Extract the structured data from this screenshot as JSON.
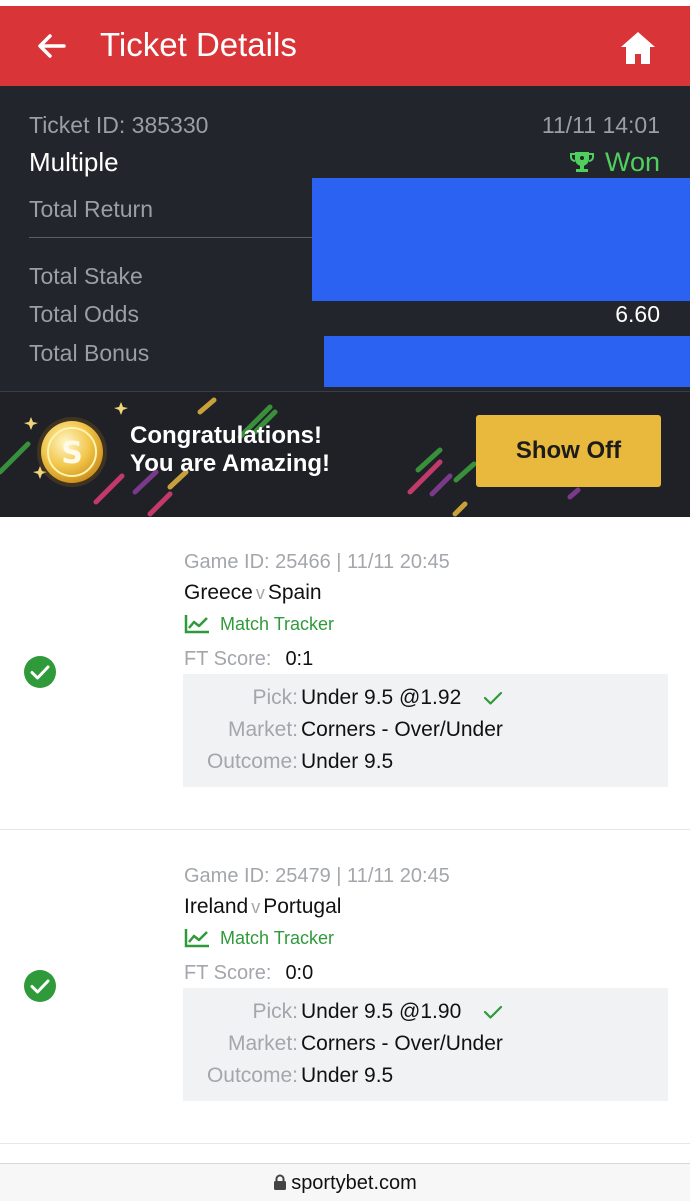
{
  "header": {
    "title": "Ticket Details",
    "back_icon": "arrow-left-icon",
    "home_icon": "home-icon"
  },
  "ticket": {
    "id_label": "Ticket ID: 385330",
    "datetime": "11/11 14:01",
    "type": "Multiple",
    "status": "Won",
    "total_return_label": "Total Return",
    "total_stake_label": "Total Stake",
    "total_odds_label": "Total Odds",
    "total_odds_value": "6.60",
    "total_bonus_label": "Total Bonus"
  },
  "banner": {
    "line1": "Congratulations!",
    "line2": "You are Amazing!",
    "button": "Show Off"
  },
  "bets": [
    {
      "game_info": "Game ID: 25466 | 11/11 20:45",
      "home": "Greece",
      "vs": "v",
      "away": "Spain",
      "tracker": "Match Tracker",
      "ft_label": "FT Score:",
      "ft_value": "0:1",
      "pick_label": "Pick:",
      "pick_value": "Under 9.5 @1.92",
      "market_label": "Market:",
      "market_value": "Corners - Over/Under",
      "outcome_label": "Outcome:",
      "outcome_value": "Under 9.5"
    },
    {
      "game_info": "Game ID: 25479 | 11/11 20:45",
      "home": "Ireland",
      "vs": "v",
      "away": "Portugal",
      "tracker": "Match Tracker",
      "ft_label": "FT Score:",
      "ft_value": "0:0",
      "pick_label": "Pick:",
      "pick_value": "Under 9.5 @1.90",
      "market_label": "Market:",
      "market_value": "Corners - Over/Under",
      "outcome_label": "Outcome:",
      "outcome_value": "Under 9.5"
    }
  ],
  "footer": {
    "url": "sportybet.com"
  },
  "colors": {
    "header_red": "#d93437",
    "summary_bg": "#22252c",
    "won_green": "#4fcf5d",
    "button_gold": "#e9b93d",
    "redaction_blue": "#2b62f1"
  }
}
